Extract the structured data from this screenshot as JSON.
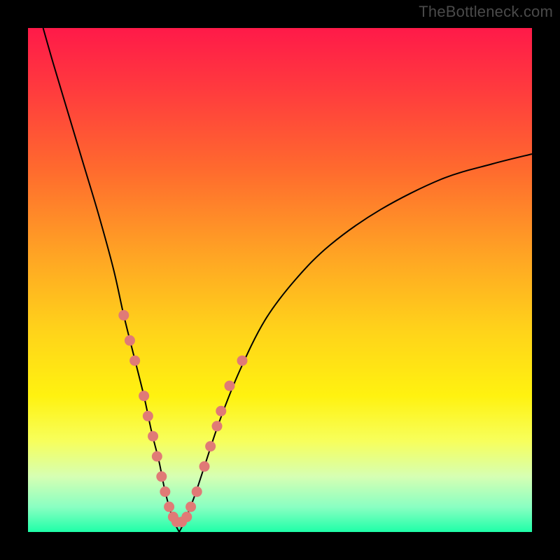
{
  "watermark": "TheBottleneck.com",
  "chart_data": {
    "type": "line",
    "title": "",
    "xlabel": "",
    "ylabel": "",
    "xlim": [
      0,
      100
    ],
    "ylim": [
      0,
      100
    ],
    "series": [
      {
        "name": "left-curve",
        "x": [
          3,
          5,
          8,
          11,
          14,
          17,
          19,
          21,
          23,
          24.5,
          26,
          27,
          28,
          29,
          30
        ],
        "y": [
          100,
          93,
          83,
          73,
          63,
          52,
          43,
          35,
          27,
          20,
          14,
          9,
          5,
          2,
          0
        ]
      },
      {
        "name": "right-curve",
        "x": [
          30,
          31,
          33,
          35,
          38,
          42,
          47,
          53,
          60,
          70,
          82,
          92,
          100
        ],
        "y": [
          0,
          2,
          7,
          13,
          22,
          32,
          42,
          50,
          57,
          64,
          70,
          73,
          75
        ]
      }
    ],
    "scatter": {
      "name": "highlighted-points",
      "points": [
        {
          "x": 19.0,
          "y": 43
        },
        {
          "x": 20.2,
          "y": 38
        },
        {
          "x": 21.2,
          "y": 34
        },
        {
          "x": 23.0,
          "y": 27
        },
        {
          "x": 23.8,
          "y": 23
        },
        {
          "x": 24.8,
          "y": 19
        },
        {
          "x": 25.6,
          "y": 15
        },
        {
          "x": 26.5,
          "y": 11
        },
        {
          "x": 27.2,
          "y": 8
        },
        {
          "x": 28.0,
          "y": 5
        },
        {
          "x": 28.8,
          "y": 3
        },
        {
          "x": 29.5,
          "y": 2
        },
        {
          "x": 30.5,
          "y": 2
        },
        {
          "x": 31.5,
          "y": 3
        },
        {
          "x": 32.3,
          "y": 5
        },
        {
          "x": 33.5,
          "y": 8
        },
        {
          "x": 35.0,
          "y": 13
        },
        {
          "x": 36.2,
          "y": 17
        },
        {
          "x": 37.5,
          "y": 21
        },
        {
          "x": 38.3,
          "y": 24
        },
        {
          "x": 40.0,
          "y": 29
        },
        {
          "x": 42.5,
          "y": 34
        }
      ]
    },
    "gradient_stops": [
      {
        "pos": 0,
        "color": "#ff1a49"
      },
      {
        "pos": 12,
        "color": "#ff3a3e"
      },
      {
        "pos": 28,
        "color": "#ff6a2e"
      },
      {
        "pos": 45,
        "color": "#ffa424"
      },
      {
        "pos": 60,
        "color": "#ffd31a"
      },
      {
        "pos": 73,
        "color": "#fff210"
      },
      {
        "pos": 82,
        "color": "#f7ff5c"
      },
      {
        "pos": 89,
        "color": "#d6ffb3"
      },
      {
        "pos": 95,
        "color": "#8affc2"
      },
      {
        "pos": 100,
        "color": "#1effa8"
      }
    ]
  }
}
